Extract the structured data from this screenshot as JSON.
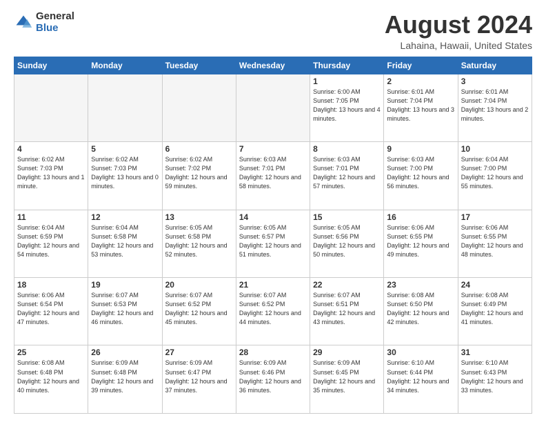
{
  "logo": {
    "general": "General",
    "blue": "Blue"
  },
  "title": {
    "month": "August 2024",
    "location": "Lahaina, Hawaii, United States"
  },
  "weekdays": [
    "Sunday",
    "Monday",
    "Tuesday",
    "Wednesday",
    "Thursday",
    "Friday",
    "Saturday"
  ],
  "weeks": [
    [
      {
        "day": "",
        "empty": true
      },
      {
        "day": "",
        "empty": true
      },
      {
        "day": "",
        "empty": true
      },
      {
        "day": "",
        "empty": true
      },
      {
        "day": "1",
        "sunrise": "6:00 AM",
        "sunset": "7:05 PM",
        "daylight": "13 hours and 4 minutes."
      },
      {
        "day": "2",
        "sunrise": "6:01 AM",
        "sunset": "7:04 PM",
        "daylight": "13 hours and 3 minutes."
      },
      {
        "day": "3",
        "sunrise": "6:01 AM",
        "sunset": "7:04 PM",
        "daylight": "13 hours and 2 minutes."
      }
    ],
    [
      {
        "day": "4",
        "sunrise": "6:02 AM",
        "sunset": "7:03 PM",
        "daylight": "13 hours and 1 minute."
      },
      {
        "day": "5",
        "sunrise": "6:02 AM",
        "sunset": "7:03 PM",
        "daylight": "13 hours and 0 minutes."
      },
      {
        "day": "6",
        "sunrise": "6:02 AM",
        "sunset": "7:02 PM",
        "daylight": "12 hours and 59 minutes."
      },
      {
        "day": "7",
        "sunrise": "6:03 AM",
        "sunset": "7:01 PM",
        "daylight": "12 hours and 58 minutes."
      },
      {
        "day": "8",
        "sunrise": "6:03 AM",
        "sunset": "7:01 PM",
        "daylight": "12 hours and 57 minutes."
      },
      {
        "day": "9",
        "sunrise": "6:03 AM",
        "sunset": "7:00 PM",
        "daylight": "12 hours and 56 minutes."
      },
      {
        "day": "10",
        "sunrise": "6:04 AM",
        "sunset": "7:00 PM",
        "daylight": "12 hours and 55 minutes."
      }
    ],
    [
      {
        "day": "11",
        "sunrise": "6:04 AM",
        "sunset": "6:59 PM",
        "daylight": "12 hours and 54 minutes."
      },
      {
        "day": "12",
        "sunrise": "6:04 AM",
        "sunset": "6:58 PM",
        "daylight": "12 hours and 53 minutes."
      },
      {
        "day": "13",
        "sunrise": "6:05 AM",
        "sunset": "6:58 PM",
        "daylight": "12 hours and 52 minutes."
      },
      {
        "day": "14",
        "sunrise": "6:05 AM",
        "sunset": "6:57 PM",
        "daylight": "12 hours and 51 minutes."
      },
      {
        "day": "15",
        "sunrise": "6:05 AM",
        "sunset": "6:56 PM",
        "daylight": "12 hours and 50 minutes."
      },
      {
        "day": "16",
        "sunrise": "6:06 AM",
        "sunset": "6:55 PM",
        "daylight": "12 hours and 49 minutes."
      },
      {
        "day": "17",
        "sunrise": "6:06 AM",
        "sunset": "6:55 PM",
        "daylight": "12 hours and 48 minutes."
      }
    ],
    [
      {
        "day": "18",
        "sunrise": "6:06 AM",
        "sunset": "6:54 PM",
        "daylight": "12 hours and 47 minutes."
      },
      {
        "day": "19",
        "sunrise": "6:07 AM",
        "sunset": "6:53 PM",
        "daylight": "12 hours and 46 minutes."
      },
      {
        "day": "20",
        "sunrise": "6:07 AM",
        "sunset": "6:52 PM",
        "daylight": "12 hours and 45 minutes."
      },
      {
        "day": "21",
        "sunrise": "6:07 AM",
        "sunset": "6:52 PM",
        "daylight": "12 hours and 44 minutes."
      },
      {
        "day": "22",
        "sunrise": "6:07 AM",
        "sunset": "6:51 PM",
        "daylight": "12 hours and 43 minutes."
      },
      {
        "day": "23",
        "sunrise": "6:08 AM",
        "sunset": "6:50 PM",
        "daylight": "12 hours and 42 minutes."
      },
      {
        "day": "24",
        "sunrise": "6:08 AM",
        "sunset": "6:49 PM",
        "daylight": "12 hours and 41 minutes."
      }
    ],
    [
      {
        "day": "25",
        "sunrise": "6:08 AM",
        "sunset": "6:48 PM",
        "daylight": "12 hours and 40 minutes."
      },
      {
        "day": "26",
        "sunrise": "6:09 AM",
        "sunset": "6:48 PM",
        "daylight": "12 hours and 39 minutes."
      },
      {
        "day": "27",
        "sunrise": "6:09 AM",
        "sunset": "6:47 PM",
        "daylight": "12 hours and 37 minutes."
      },
      {
        "day": "28",
        "sunrise": "6:09 AM",
        "sunset": "6:46 PM",
        "daylight": "12 hours and 36 minutes."
      },
      {
        "day": "29",
        "sunrise": "6:09 AM",
        "sunset": "6:45 PM",
        "daylight": "12 hours and 35 minutes."
      },
      {
        "day": "30",
        "sunrise": "6:10 AM",
        "sunset": "6:44 PM",
        "daylight": "12 hours and 34 minutes."
      },
      {
        "day": "31",
        "sunrise": "6:10 AM",
        "sunset": "6:43 PM",
        "daylight": "12 hours and 33 minutes."
      }
    ]
  ]
}
